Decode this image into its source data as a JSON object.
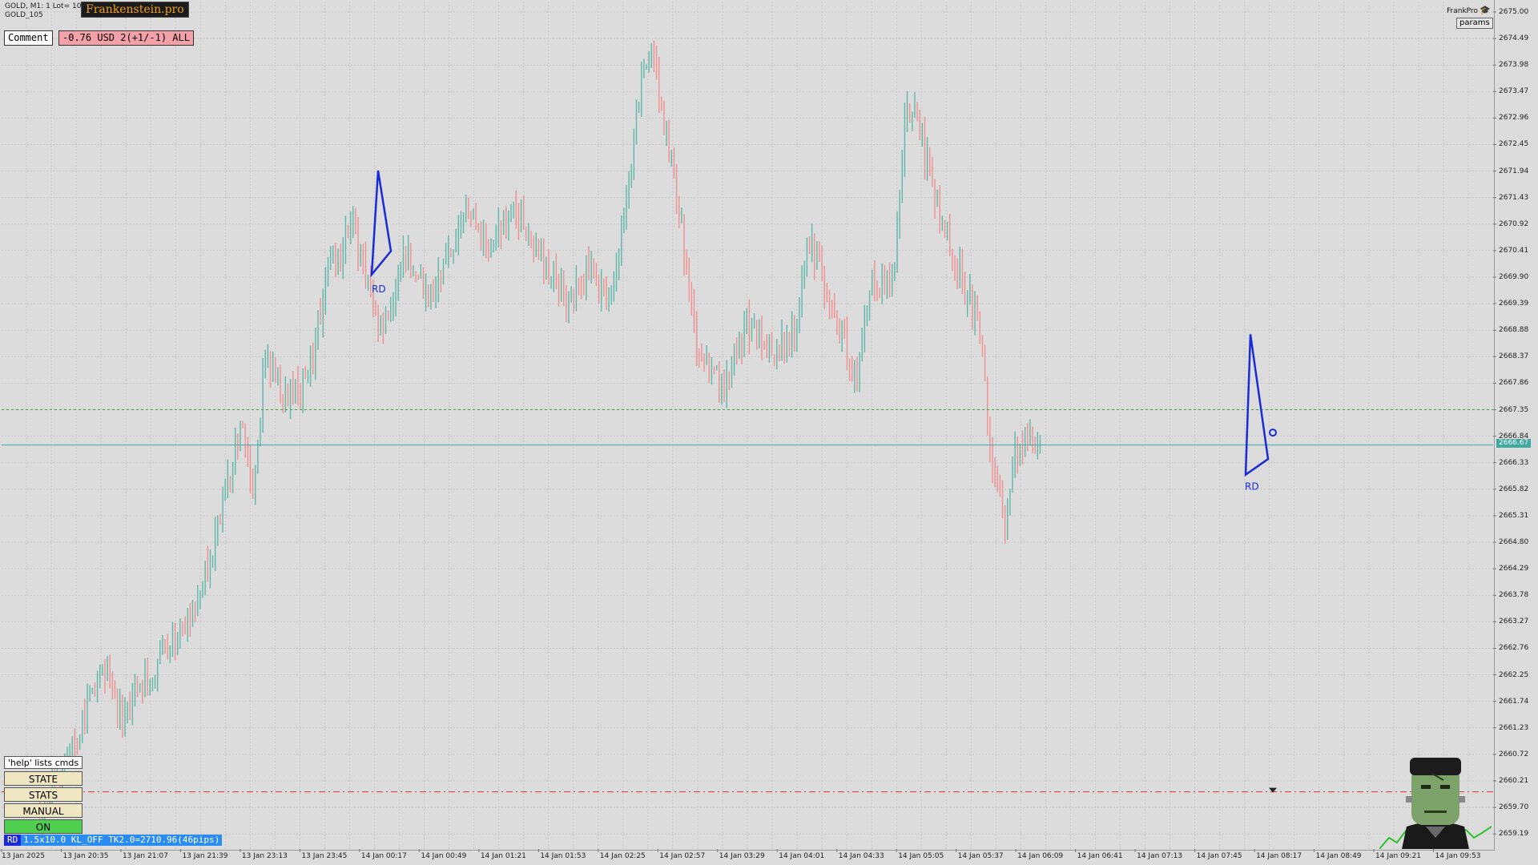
{
  "header": {
    "symbol_line": "GOLD, M1:  1 Lot= 10",
    "account_line": "GOLD_105",
    "brand": "Frankenstein.pro",
    "comment_label": "Comment",
    "profit_text": "-0.76 USD 2(+1/-1) ALL",
    "frankpro_label": "FrankPro",
    "params_label": "params"
  },
  "panel": {
    "help": "'help' lists cmds",
    "buttons": [
      {
        "label": "STATE"
      },
      {
        "label": "STATS"
      },
      {
        "label": "MANUAL"
      },
      {
        "label": "ON"
      }
    ],
    "status_tag": "RD",
    "status_text": "1.5x10.0 KL_OFF TK2.0=2710.96(46pips)"
  },
  "current_price": "2666.67",
  "colors": {
    "bull": "#5fb8a8",
    "bear": "#f09090",
    "pattern": "#1a2ad6",
    "price_line": "#3fa9a0",
    "stop_line": "#e03030",
    "background": "#dcdcdc"
  },
  "chart_data": {
    "type": "candlestick",
    "symbol": "GOLD",
    "timeframe": "M1",
    "ylim": [
      2658.9,
      2675.2
    ],
    "y_ticks": [
      "2675.00",
      "2674.49",
      "2673.98",
      "2673.47",
      "2672.96",
      "2672.45",
      "2671.94",
      "2671.43",
      "2670.92",
      "2670.41",
      "2669.90",
      "2669.39",
      "2668.88",
      "2668.37",
      "2667.86",
      "2667.35",
      "2666.84",
      "2666.33",
      "2665.82",
      "2665.31",
      "2664.80",
      "2664.29",
      "2663.78",
      "2663.27",
      "2662.76",
      "2662.25",
      "2661.74",
      "2661.23",
      "2660.72",
      "2660.21",
      "2659.70",
      "2659.19"
    ],
    "x_ticks": [
      "13 Jan 2025",
      "13 Jan 20:35",
      "13 Jan 21:07",
      "13 Jan 21:39",
      "13 Jan 23:13",
      "13 Jan 23:45",
      "14 Jan 00:17",
      "14 Jan 00:49",
      "14 Jan 01:21",
      "14 Jan 01:53",
      "14 Jan 02:25",
      "14 Jan 02:57",
      "14 Jan 03:29",
      "14 Jan 04:01",
      "14 Jan 04:33",
      "14 Jan 05:05",
      "14 Jan 05:37",
      "14 Jan 06:09",
      "14 Jan 06:41",
      "14 Jan 07:13",
      "14 Jan 07:45",
      "14 Jan 08:17",
      "14 Jan 08:49",
      "14 Jan 09:21",
      "14 Jan 09:53"
    ],
    "path": [
      [
        0,
        2659.6
      ],
      [
        0.03,
        2661.0
      ],
      [
        0.05,
        2662.3
      ],
      [
        0.07,
        2661.5
      ],
      [
        0.09,
        2662.3
      ],
      [
        0.11,
        2662.9
      ],
      [
        0.13,
        2663.6
      ],
      [
        0.15,
        2665.6
      ],
      [
        0.165,
        2667.0
      ],
      [
        0.175,
        2665.8
      ],
      [
        0.185,
        2668.4
      ],
      [
        0.2,
        2667.6
      ],
      [
        0.22,
        2667.8
      ],
      [
        0.235,
        2669.9
      ],
      [
        0.245,
        2670.2
      ],
      [
        0.255,
        2671.0
      ],
      [
        0.265,
        2670.2
      ],
      [
        0.28,
        2668.7
      ],
      [
        0.3,
        2670.3
      ],
      [
        0.32,
        2669.5
      ],
      [
        0.35,
        2671.1
      ],
      [
        0.37,
        2670.5
      ],
      [
        0.39,
        2671.2
      ],
      [
        0.41,
        2670.4
      ],
      [
        0.43,
        2669.5
      ],
      [
        0.45,
        2670.0
      ],
      [
        0.47,
        2669.4
      ],
      [
        0.49,
        2673.1
      ],
      [
        0.5,
        2674.5
      ],
      [
        0.51,
        2673.2
      ],
      [
        0.52,
        2671.9
      ],
      [
        0.54,
        2668.3
      ],
      [
        0.56,
        2667.8
      ],
      [
        0.58,
        2669.0
      ],
      [
        0.6,
        2668.5
      ],
      [
        0.62,
        2668.9
      ],
      [
        0.63,
        2670.6
      ],
      [
        0.65,
        2669.4
      ],
      [
        0.67,
        2667.7
      ],
      [
        0.68,
        2669.8
      ],
      [
        0.7,
        2669.6
      ],
      [
        0.71,
        2673.3
      ],
      [
        0.72,
        2673.0
      ],
      [
        0.73,
        2671.7
      ],
      [
        0.75,
        2670.2
      ],
      [
        0.77,
        2669.0
      ],
      [
        0.78,
        2666.5
      ],
      [
        0.79,
        2665.0
      ],
      [
        0.8,
        2666.6
      ],
      [
        0.81,
        2666.8
      ],
      [
        0.82,
        2666.7
      ]
    ],
    "annotations": [
      {
        "label": "RD",
        "time_index": 0.243
      },
      {
        "label": "RD",
        "time_index": 0.81
      }
    ],
    "horizontal_lines": [
      {
        "price": 2667.35,
        "style": "dotted",
        "color": "#3fa040"
      },
      {
        "price": 2666.67,
        "style": "solid",
        "color": "#3fa9a0"
      },
      {
        "price": 2660.0,
        "style": "dash-dot",
        "color": "#e03030"
      }
    ]
  }
}
